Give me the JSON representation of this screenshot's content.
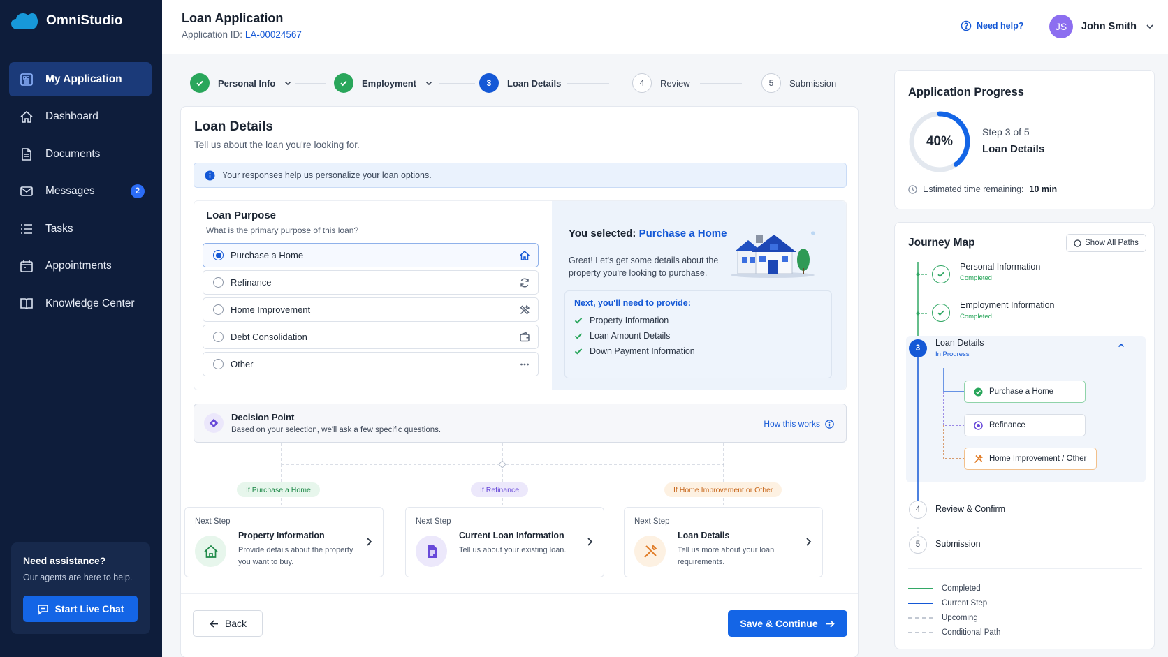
{
  "sidebar": {
    "brand": "OmniStudio",
    "items": [
      {
        "label": "My Application",
        "icon": "application-icon"
      },
      {
        "label": "Dashboard",
        "icon": "home-icon"
      },
      {
        "label": "Documents",
        "icon": "document-icon"
      },
      {
        "label": "Messages",
        "icon": "mail-icon",
        "badge": "2"
      },
      {
        "label": "Tasks",
        "icon": "list-icon"
      },
      {
        "label": "Appointments",
        "icon": "calendar-icon"
      },
      {
        "label": "Knowledge Center",
        "icon": "book-icon"
      }
    ],
    "assist": {
      "title": "Need assistance?",
      "subtitle": "Our agents are here to help.",
      "button": "Start Live Chat"
    }
  },
  "header": {
    "title": "Loan Application",
    "id_label": "Application ID:",
    "id_value": "LA-00024567",
    "help": "Need help?",
    "user_initials": "JS",
    "user_name": "John Smith"
  },
  "stepper": [
    {
      "label": "Personal Info",
      "status": "completed"
    },
    {
      "label": "Employment",
      "status": "completed"
    },
    {
      "num": "3",
      "label": "Loan Details",
      "status": "current"
    },
    {
      "num": "4",
      "label": "Review",
      "status": "upcoming"
    },
    {
      "num": "5",
      "label": "Submission",
      "status": "upcoming"
    }
  ],
  "main": {
    "title": "Loan Details",
    "subtitle": "Tell us about the loan you're looking for.",
    "info": "Your responses help us personalize your loan options.",
    "purpose": {
      "title": "Loan Purpose",
      "question": "What is the primary purpose of this loan?",
      "options": [
        {
          "label": "Purchase a Home",
          "icon": "home-icon",
          "selected": true
        },
        {
          "label": "Refinance",
          "icon": "refresh-icon",
          "selected": false
        },
        {
          "label": "Home Improvement",
          "icon": "tools-icon",
          "selected": false
        },
        {
          "label": "Debt Consolidation",
          "icon": "wallet-icon",
          "selected": false
        },
        {
          "label": "Other",
          "icon": "more-icon",
          "selected": false
        }
      ]
    },
    "selection": {
      "prefix": "You selected:",
      "value": "Purchase a Home",
      "description": "Great! Let's get some details about the property you're looking to purchase.",
      "needs_title": "Next, you'll need to provide:",
      "needs": [
        "Property Information",
        "Loan Amount Details",
        "Down Payment Information"
      ]
    },
    "decision": {
      "title": "Decision Point",
      "subtitle": "Based on your selection, we'll ask a few specific questions.",
      "link": "How this works"
    },
    "branches": [
      {
        "condition": "If Purchase a Home",
        "next": "Next Step",
        "title": "Property Information",
        "desc": "Provide details about the property you want to buy.",
        "color": "#1f8a49"
      },
      {
        "condition": "If Refinance",
        "next": "Next Step",
        "title": "Current Loan Information",
        "desc": "Tell us about your existing loan.",
        "color": "#6849d9"
      },
      {
        "condition": "If Home Improvement or Other",
        "next": "Next Step",
        "title": "Loan Details",
        "desc": "Tell us more about your loan requirements.",
        "color": "#c7661a"
      }
    ],
    "back": "Back",
    "save": "Save & Continue"
  },
  "progress": {
    "title": "Application Progress",
    "percent": 40,
    "percent_label": "40%",
    "step": "Step 3 of 5",
    "name": "Loan Details",
    "est_label": "Estimated time remaining:",
    "est_value": "10 min"
  },
  "journey": {
    "title": "Journey Map",
    "show_all": "Show All Paths",
    "steps": [
      {
        "title": "Personal Information",
        "status": "Completed"
      },
      {
        "title": "Employment Information",
        "status": "Completed"
      },
      {
        "num": "3",
        "title": "Loan Details",
        "status": "In Progress"
      },
      {
        "num": "4",
        "title": "Review & Confirm"
      },
      {
        "num": "5",
        "title": "Submission"
      }
    ],
    "paths": [
      "Purchase a Home",
      "Refinance",
      "Home Improvement / Other"
    ],
    "legend": [
      "Completed",
      "Current Step",
      "Upcoming",
      "Conditional Path"
    ]
  },
  "colors": {
    "sidebar": "#0e1d3b",
    "primary": "#1465e6",
    "success": "#29a65b",
    "purple": "#6849d9",
    "orange": "#c7661a"
  }
}
